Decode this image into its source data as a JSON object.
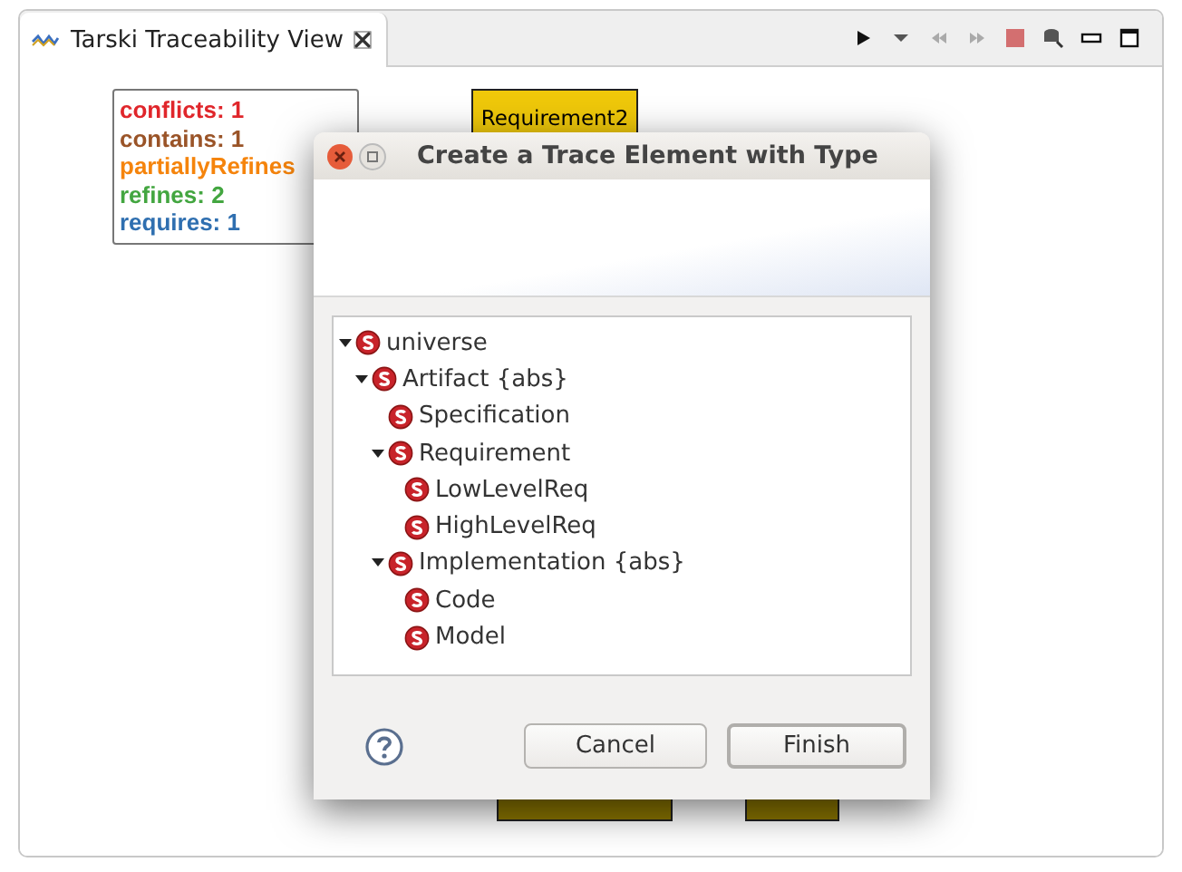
{
  "view": {
    "title": "Tarski Traceability View"
  },
  "legend": [
    {
      "label": "conflicts: 1",
      "color": "#e0262b"
    },
    {
      "label": "contains: 1",
      "color": "#9a5428"
    },
    {
      "label": "partiallyRefines",
      "color": "#f5840c"
    },
    {
      "label": "refines: 2",
      "color": "#43a640"
    },
    {
      "label": "requires: 1",
      "color": "#2f6fb0"
    }
  ],
  "nodes": [
    {
      "label": "Requirement2"
    }
  ],
  "dialog": {
    "title": "Create a Trace Element with Type",
    "tree": [
      {
        "label": "universe",
        "expanded": true,
        "children": [
          {
            "label": "Artifact {abs}",
            "expanded": true,
            "children": [
              {
                "label": "Specification"
              },
              {
                "label": "Requirement",
                "expanded": true,
                "children": [
                  {
                    "label": "LowLevelReq"
                  },
                  {
                    "label": "HighLevelReq"
                  }
                ]
              },
              {
                "label": "Implementation {abs}",
                "expanded": true,
                "children": [
                  {
                    "label": "Code"
                  },
                  {
                    "label": "Model"
                  }
                ]
              }
            ]
          }
        ]
      }
    ],
    "buttons": [
      {
        "label": "Cancel",
        "default": false
      },
      {
        "label": "Finish",
        "default": true
      }
    ]
  }
}
